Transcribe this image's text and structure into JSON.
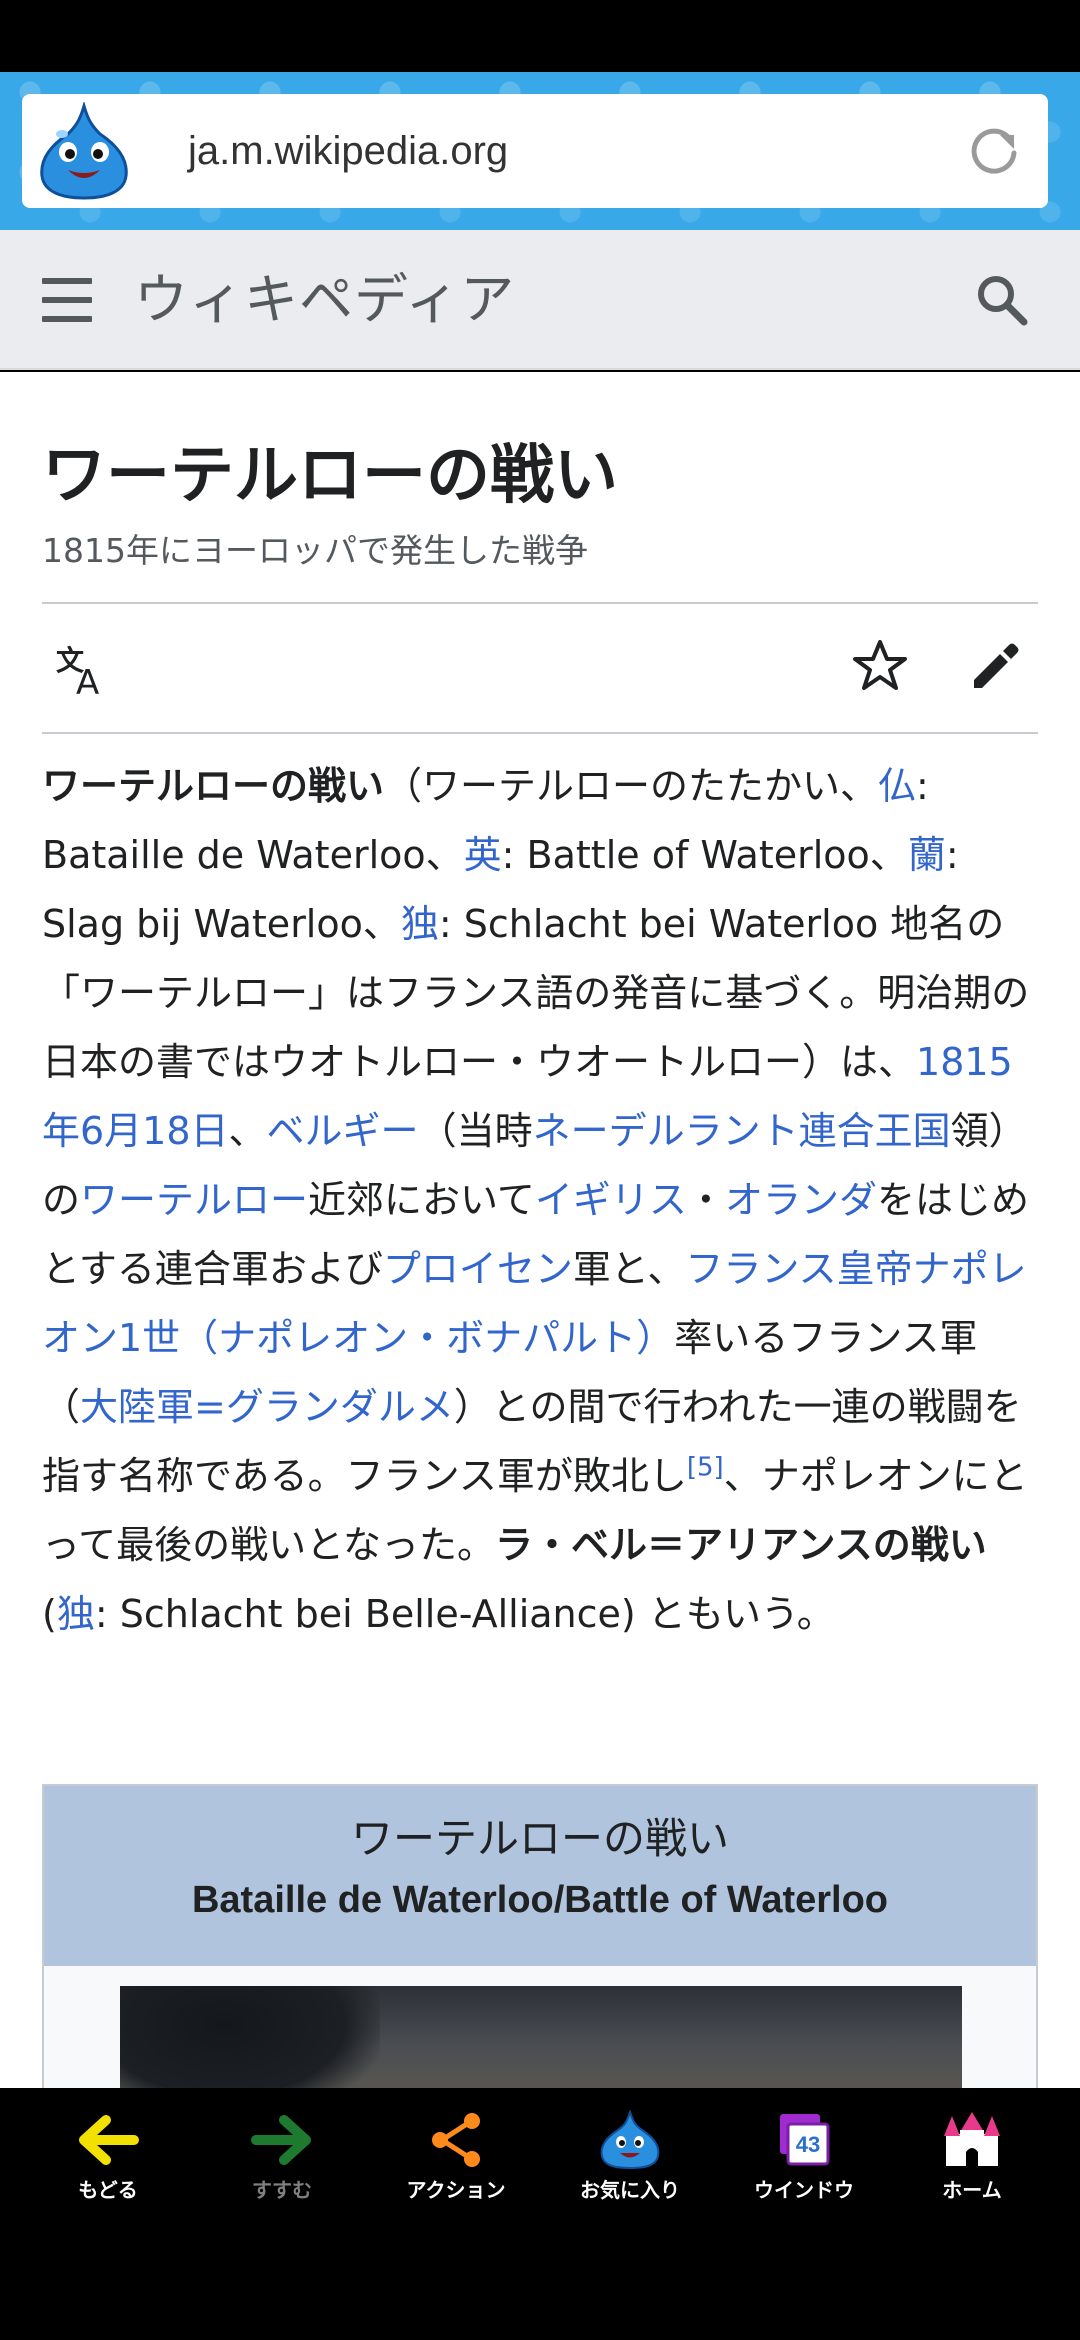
{
  "browser": {
    "url": "ja.m.wikipedia.org",
    "theme_color": "#39a8e8"
  },
  "wiki_header": {
    "logo_text": "ウィキペディア"
  },
  "article": {
    "title": "ワーテルローの戦い",
    "subtitle": "1815年にヨーロッパで発生した戦争",
    "p": {
      "t1": "ワーテルローの戦い",
      "t2": "（ワーテルローのたたかい、",
      "l1": "仏",
      "t3": ": Bataille de Waterloo、",
      "l2": "英",
      "t4": ": Battle of Waterloo、",
      "l3": "蘭",
      "t5": ": Slag bij Waterloo、",
      "l4": "独",
      "t6": ": Schlacht bei Waterloo 地名の「ワーテルロー」はフランス語の発音に基づく。明治期の日本の書ではウオトルロー・ウオートルロー）は、",
      "l5": "1815年6月18日",
      "t7": "、",
      "l6": "ベルギー",
      "t8": "（当時",
      "l7": "ネーデルラント連合王国",
      "t9": "領）の",
      "l8": "ワーテルロー",
      "t10": "近郊において",
      "l9": "イギリス",
      "t11": "・",
      "l10": "オランダ",
      "t12": "をはじめとする連合軍および",
      "l11": "プロイセン",
      "t13": "軍と、",
      "l12": "フランス皇帝ナポレオン1世（ナポレオン・ボナパルト）",
      "t14": "率いるフランス軍（",
      "l13": "大陸軍=グランダルメ",
      "t15": "）との間で行われた一連の戦闘を指す名称である。フランス軍が敗北し",
      "ref": "[5]",
      "t16": "、ナポレオンにとって最後の戦いとなった。",
      "t17": "ラ・ベル＝アリアンスの戦い",
      "t18": " (",
      "l14": "独",
      "t19": ": Schlacht bei Belle-Alliance) ともいう。"
    }
  },
  "infobox": {
    "title": "ワーテルローの戦い",
    "subtitle": "Bataille de Waterloo/Battle of Waterloo"
  },
  "bottom_nav": [
    {
      "label": "もどる",
      "icon": "back-arrow-icon"
    },
    {
      "label": "すすむ",
      "icon": "forward-arrow-icon"
    },
    {
      "label": "アクション",
      "icon": "share-icon"
    },
    {
      "label": "お気に入り",
      "icon": "slime-favorite-icon"
    },
    {
      "label": "ウインドウ",
      "icon": "window-icon",
      "badge": "43"
    },
    {
      "label": "ホーム",
      "icon": "castle-home-icon"
    }
  ]
}
